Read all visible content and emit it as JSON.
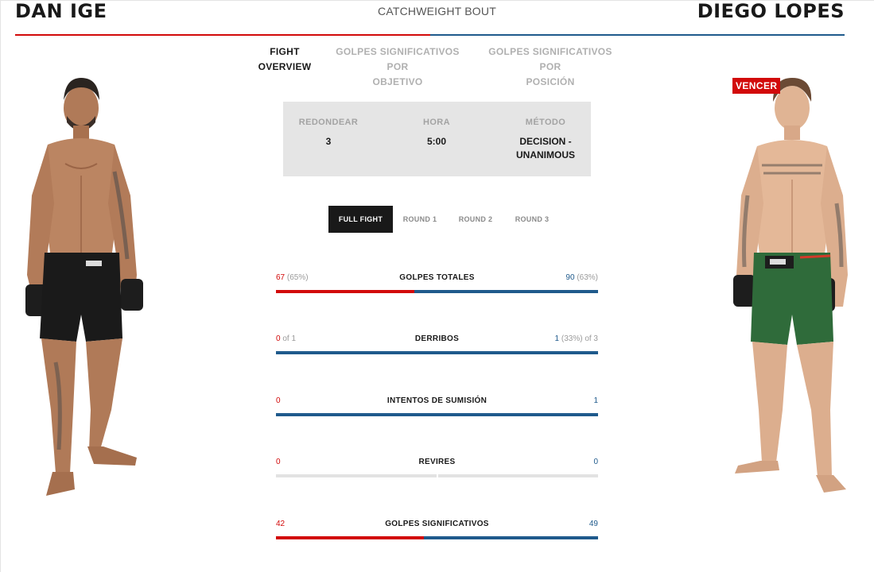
{
  "header": {
    "red_fighter": "DAN IGE",
    "blue_fighter": "DIEGO LOPES",
    "weight_class": "CATCHWEIGHT BOUT"
  },
  "tabs": [
    {
      "line1": "FIGHT",
      "line2": "OVERVIEW",
      "active": true
    },
    {
      "line1": "GOLPES SIGNIFICATIVOS POR",
      "line2": "OBJETIVO",
      "active": false
    },
    {
      "line1": "GOLPES SIGNIFICATIVOS POR",
      "line2": "POSICIÓN",
      "active": false
    }
  ],
  "winner_badge": "VENCER",
  "result": {
    "round_label": "REDONDEAR",
    "round_value": "3",
    "time_label": "HORA",
    "time_value": "5:00",
    "method_label": "MÉTODO",
    "method_value_line1": "DECISION -",
    "method_value_line2": "UNANIMOUS"
  },
  "round_tabs": [
    {
      "label": "FULL FIGHT",
      "active": true
    },
    {
      "label": "ROUND 1",
      "active": false
    },
    {
      "label": "ROUND 2",
      "active": false
    },
    {
      "label": "ROUND 3",
      "active": false
    }
  ],
  "stats": [
    {
      "label": "GOLPES TOTALES",
      "red_value": "67",
      "red_detail": "(65%)",
      "blue_value": "90",
      "blue_detail": "(63%)",
      "red_share": 0.43
    },
    {
      "label": "DERRIBOS",
      "red_value": "0",
      "red_detail": "of 1",
      "blue_value": "1",
      "blue_detail": "(33%) of 3",
      "red_share": 0.0
    },
    {
      "label": "INTENTOS DE SUMISIÓN",
      "red_value": "0",
      "red_detail": "",
      "blue_value": "1",
      "blue_detail": "",
      "red_share": 0.0
    },
    {
      "label": "REVIRES",
      "red_value": "0",
      "red_detail": "",
      "blue_value": "0",
      "blue_detail": "",
      "red_share": null
    },
    {
      "label": "GOLPES SIGNIFICATIVOS",
      "red_value": "42",
      "red_detail": "",
      "blue_value": "49",
      "blue_detail": "",
      "red_share": 0.46
    }
  ],
  "colors": {
    "red_corner": "#d20a0a",
    "blue_corner": "#1f5a8c",
    "active_tab_bg": "#191919",
    "result_bg": "#e5e5e5"
  }
}
